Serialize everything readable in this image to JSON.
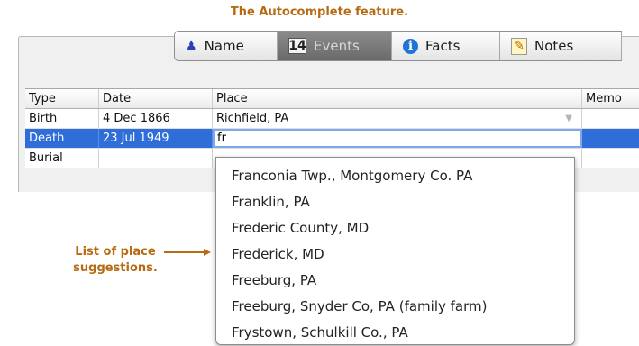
{
  "caption": "The Autocomplete feature.",
  "tabs": [
    {
      "label": "Name",
      "icon": "person-icon"
    },
    {
      "label": "Events",
      "icon": "calendar-icon",
      "icon_text": "14"
    },
    {
      "label": "Facts",
      "icon": "info-icon",
      "icon_text": "i"
    },
    {
      "label": "Notes",
      "icon": "notepad-icon"
    }
  ],
  "table": {
    "columns": [
      "Type",
      "Date",
      "Place",
      "Memo"
    ],
    "rows": [
      {
        "type": "Birth",
        "date": "4 Dec 1866",
        "place": "Richfield, PA",
        "memo": ""
      },
      {
        "type": "Death",
        "date": "23 Jul 1949",
        "place": "fr",
        "memo": ""
      },
      {
        "type": "Burial",
        "date": "",
        "place": "",
        "memo": ""
      }
    ]
  },
  "suggestions": [
    "Franconia Twp., Montgomery Co. PA",
    "Franklin, PA",
    "Frederic County, MD",
    "Frederick, MD",
    "Freeburg, PA",
    "Freeburg, Snyder Co, PA (family farm)",
    "Frystown, Schulkill Co., PA"
  ],
  "annotation": {
    "line1": "List of place",
    "line2": "suggestions."
  },
  "colors": {
    "accent": "#b86a12",
    "selection": "#2f6ed8",
    "active_tab": "#7a7a7a"
  }
}
